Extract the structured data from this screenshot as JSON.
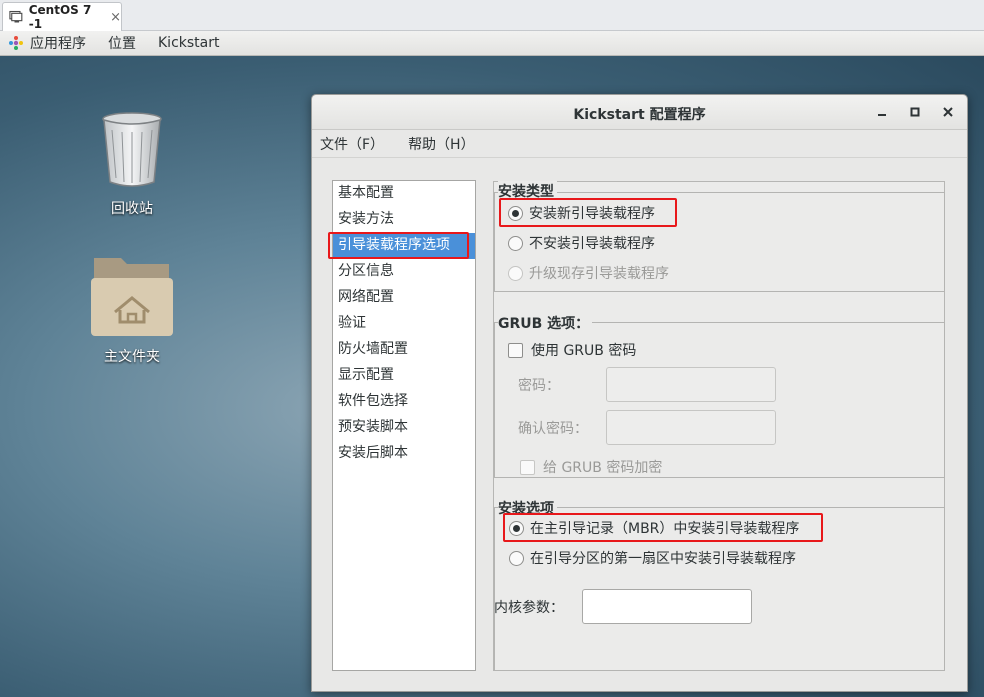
{
  "vm_tab": {
    "title": "CentOS 7 -1",
    "close": "×"
  },
  "panel": {
    "applications": "应用程序",
    "places": "位置",
    "app": "Kickstart"
  },
  "desktop": {
    "trash_label": "回收站",
    "home_label": "主文件夹"
  },
  "window": {
    "title": "Kickstart 配置程序",
    "controls": {
      "minimize": "‒",
      "maximize": "□",
      "close": "×"
    },
    "menu": {
      "file": "文件（F）",
      "help": "帮助（H）"
    }
  },
  "nav": {
    "items": [
      {
        "label": "基本配置"
      },
      {
        "label": "安装方法"
      },
      {
        "label": "引导装载程序选项"
      },
      {
        "label": "分区信息"
      },
      {
        "label": "网络配置"
      },
      {
        "label": "验证"
      },
      {
        "label": "防火墙配置"
      },
      {
        "label": "显示配置"
      },
      {
        "label": "软件包选择"
      },
      {
        "label": "预安装脚本"
      },
      {
        "label": "安装后脚本"
      }
    ],
    "selected_index": 2
  },
  "install_type": {
    "title": "安装类型",
    "options": [
      {
        "label": "安装新引导装载程序",
        "selected": true,
        "enabled": true
      },
      {
        "label": "不安装引导装载程序",
        "selected": false,
        "enabled": true
      },
      {
        "label": "升级现存引导装载程序",
        "selected": false,
        "enabled": false
      }
    ]
  },
  "grub": {
    "title": "GRUB 选项：",
    "use_password_label": "使用  GRUB 密码",
    "password_label": "密码：",
    "password_value": "",
    "confirm_label": "确认密码：",
    "confirm_value": "",
    "encrypt_label": "给  GRUB 密码加密"
  },
  "install_options": {
    "title": "安装选项",
    "options": [
      {
        "label": "在主引导记录（MBR）中安装引导装载程序",
        "selected": true
      },
      {
        "label": "在引导分区的第一扇区中安装引导装载程序",
        "selected": false
      }
    ]
  },
  "kernel": {
    "label": "内核参数：",
    "value": ""
  },
  "colors": {
    "highlight": "#e8181b",
    "selection": "#4a90d9"
  }
}
